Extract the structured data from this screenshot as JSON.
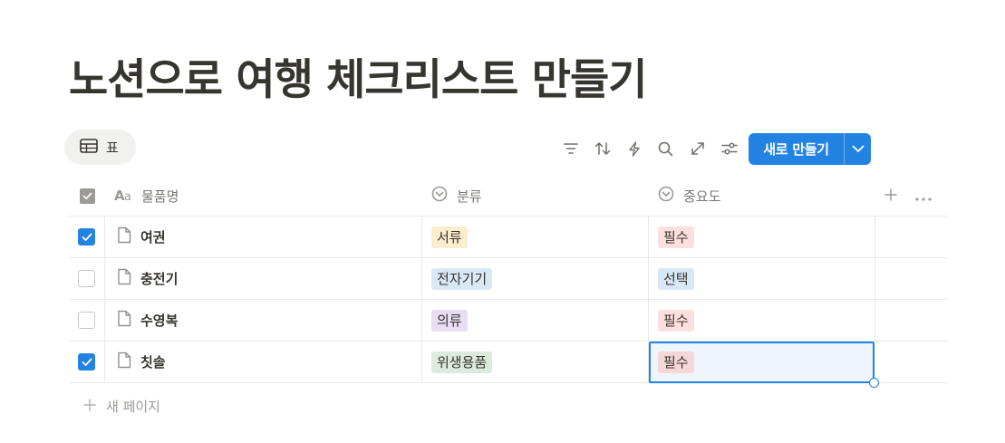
{
  "page": {
    "title": "노션으로 여행 체크리스트 만들기"
  },
  "view": {
    "label": "표",
    "icon": "table-icon"
  },
  "toolbar": {
    "icons": [
      "filter-icon",
      "sort-icon",
      "automation-icon",
      "search-icon",
      "expand-icon",
      "settings-icon"
    ],
    "new_button": "새로 만들기"
  },
  "table": {
    "columns": [
      {
        "label": "물품명",
        "icon": "text-type-icon"
      },
      {
        "label": "분류",
        "icon": "select-icon"
      },
      {
        "label": "중요도",
        "icon": "select-icon"
      }
    ],
    "rows": [
      {
        "checked": true,
        "name": "여권",
        "category": "서류",
        "category_color": "#fbeecc",
        "importance": "필수",
        "importance_color": "#fde0dd"
      },
      {
        "checked": false,
        "name": "충전기",
        "category": "전자기기",
        "category_color": "#d8e8f5",
        "importance": "선택",
        "importance_color": "#d8e8f5"
      },
      {
        "checked": false,
        "name": "수영복",
        "category": "의류",
        "category_color": "#e8def3",
        "importance": "필수",
        "importance_color": "#fde0dd"
      },
      {
        "checked": true,
        "name": "칫솔",
        "category": "위생용품",
        "category_color": "#dcebdd",
        "importance": "필수",
        "importance_color": "#f6d7d8"
      }
    ],
    "new_page_label": "새 페이지"
  },
  "colors": {
    "accent": "#2383e2",
    "text": "#37352f",
    "muted": "#787774"
  }
}
